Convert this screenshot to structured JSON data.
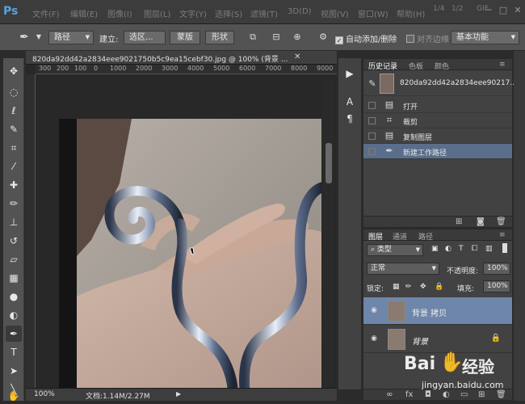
{
  "menubar": {
    "logo": "Ps",
    "items": [
      "文件(F)",
      "编辑(E)",
      "图像(I)",
      "图层(L)",
      "文字(Y)",
      "选择(S)",
      "滤镜(T)",
      "3D(D)",
      "视图(V)",
      "窗口(W)",
      "帮助(H)"
    ],
    "extra": [
      "1/4",
      "1/2",
      "GIF"
    ],
    "window_controls": [
      "─",
      "□",
      "✕"
    ]
  },
  "options": {
    "mode_select": "路径",
    "build_label": "建立:",
    "btn_selection": "选区...",
    "btn_mask": "蒙版",
    "btn_shape": "形状",
    "auto_add_delete": "自动添加/删除",
    "align_edges": "对齐边缘",
    "workspace": "基本功能"
  },
  "document": {
    "tab_title": "820da92dd42a2834eee9021750b5c9ea15cebf30.jpg @ 100% (背景 ...",
    "ruler_ticks": [
      "300",
      "200",
      "100",
      "0",
      "1000",
      "2000",
      "3000",
      "4000",
      "5000",
      "6000",
      "7000",
      "8000",
      "9000"
    ],
    "zoom": "100%",
    "doc_size": "文档:1.14M/2.27M"
  },
  "history_panel": {
    "tabs": [
      "历史记录",
      "色板",
      "颜色"
    ],
    "snapshot_name": "820da92dd42a2834eee90217...",
    "items": [
      {
        "icon": "document-icon",
        "label": "打开",
        "selected": false
      },
      {
        "icon": "crop-icon",
        "label": "裁剪",
        "selected": false
      },
      {
        "icon": "document-icon",
        "label": "复制图层",
        "selected": false
      },
      {
        "icon": "pen-icon",
        "label": "新建工作路径",
        "selected": true
      }
    ]
  },
  "layers_panel": {
    "tabs": [
      "图层",
      "通道",
      "路径"
    ],
    "filter_kind": "类型",
    "blend_mode": "正常",
    "opacity_label": "不透明度:",
    "opacity": "100%",
    "lock_label": "锁定:",
    "fill_label": "填充:",
    "fill": "100%",
    "layers": [
      {
        "name": "背景 拷贝",
        "selected": true,
        "locked": false
      },
      {
        "name": "背景",
        "selected": false,
        "locked": true
      }
    ]
  },
  "watermark": {
    "brand_left": "Bai",
    "brand_right": "经验",
    "url": "jingyan.baidu.com"
  },
  "colors": {
    "selection": "#5a6e8c",
    "layer_selection": "#6e86aa",
    "panel_bg": "#424242"
  }
}
